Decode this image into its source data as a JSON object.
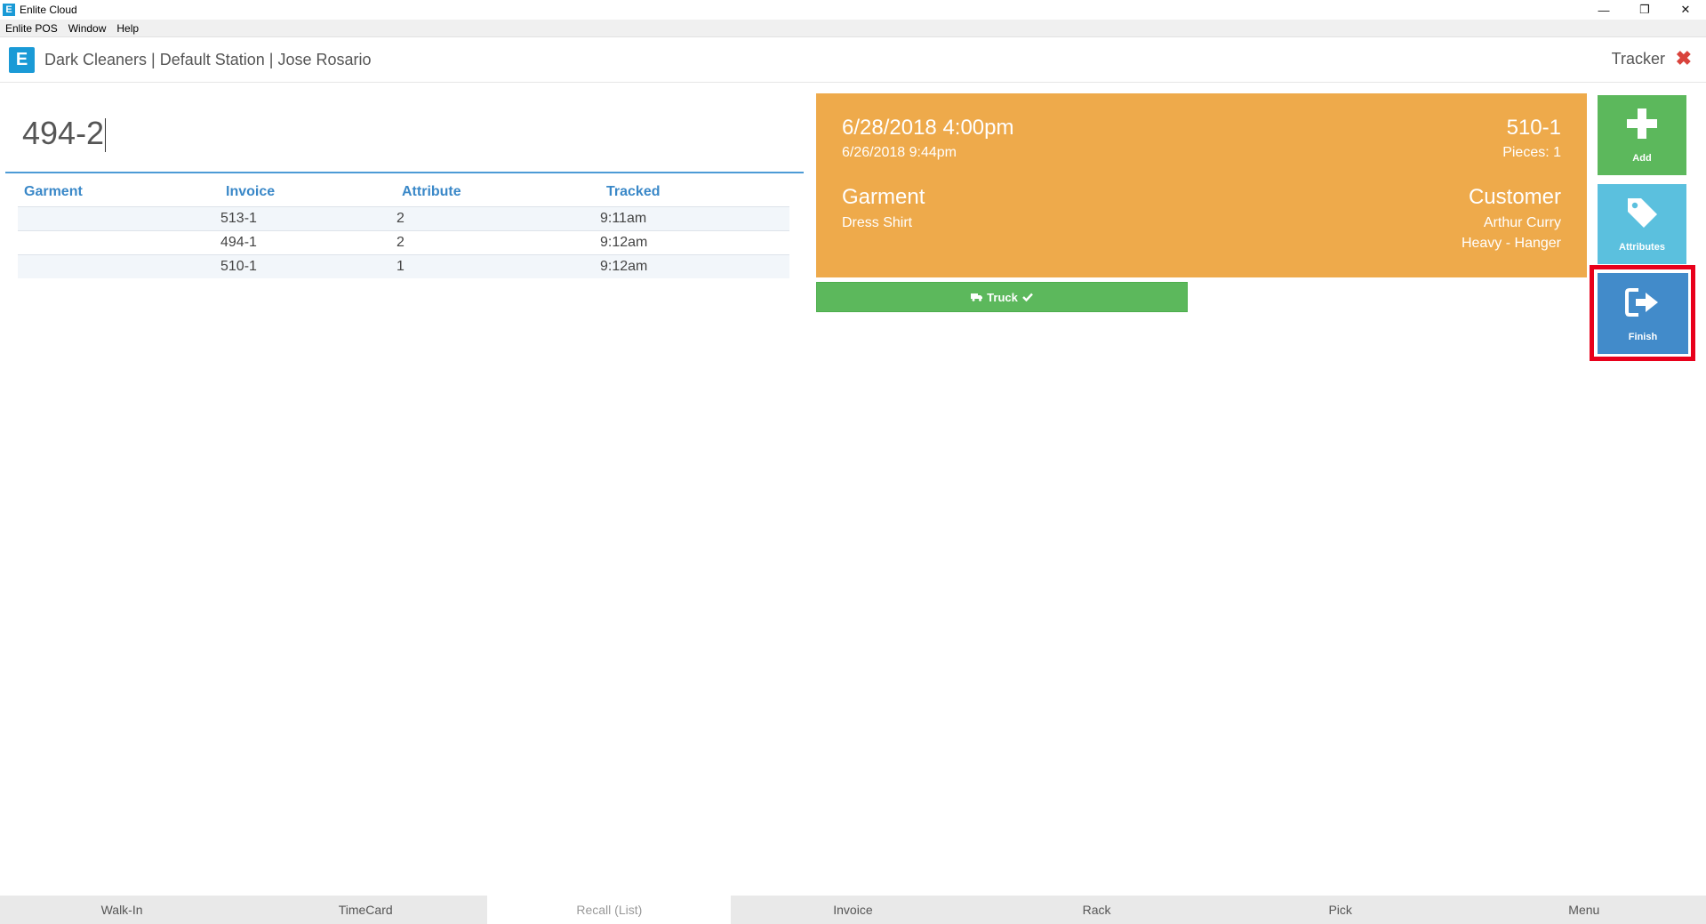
{
  "window": {
    "title": "Enlite Cloud",
    "icon_letter": "E",
    "controls": {
      "minimize": "—",
      "restore": "❐",
      "close": "✕"
    }
  },
  "menu": [
    "Enlite POS",
    "Window",
    "Help"
  ],
  "header": {
    "logo_letter": "E",
    "breadcrumb": "Dark Cleaners | Default Station | Jose Rosario",
    "tracker_label": "Tracker",
    "close_glyph": "✖"
  },
  "entry": {
    "value": "494-2"
  },
  "table": {
    "headers": {
      "garment": "Garment",
      "invoice": "Invoice",
      "attribute": "Attribute",
      "tracked": "Tracked"
    },
    "rows": [
      {
        "garment": "",
        "invoice": "513-1",
        "attribute": "2",
        "tracked": "9:11am"
      },
      {
        "garment": "",
        "invoice": "494-1",
        "attribute": "2",
        "tracked": "9:12am"
      },
      {
        "garment": "",
        "invoice": "510-1",
        "attribute": "1",
        "tracked": "9:12am"
      }
    ]
  },
  "card": {
    "due_date": "6/28/2018 4:00pm",
    "drop_date": "6/26/2018 9:44pm",
    "invoice": "510-1",
    "pieces": "Pieces: 1",
    "garment_label": "Garment",
    "garment_value": "Dress Shirt",
    "customer_label": "Customer",
    "customer_name": "Arthur Curry",
    "customer_attribute": "Heavy - Hanger",
    "color": "#eeaa4b"
  },
  "route_bar": {
    "label": "Truck",
    "icon": "truck-icon",
    "check_icon": "check-icon"
  },
  "actions": {
    "add": {
      "label": "Add",
      "icon": "plus-icon",
      "color": "#5cb85c"
    },
    "attributes": {
      "label": "Attributes",
      "icon": "tag-icon",
      "color": "#5bc0de"
    },
    "finish": {
      "label": "Finish",
      "icon": "sign-out-icon",
      "color": "#428bca",
      "highlight_color": "#e8001b"
    }
  },
  "nav": [
    {
      "label": "Walk-In",
      "active": false
    },
    {
      "label": "TimeCard",
      "active": false
    },
    {
      "label": "Recall (List)",
      "active": true
    },
    {
      "label": "Invoice",
      "active": false
    },
    {
      "label": "Rack",
      "active": false
    },
    {
      "label": "Pick",
      "active": false
    },
    {
      "label": "Menu",
      "active": false
    }
  ]
}
